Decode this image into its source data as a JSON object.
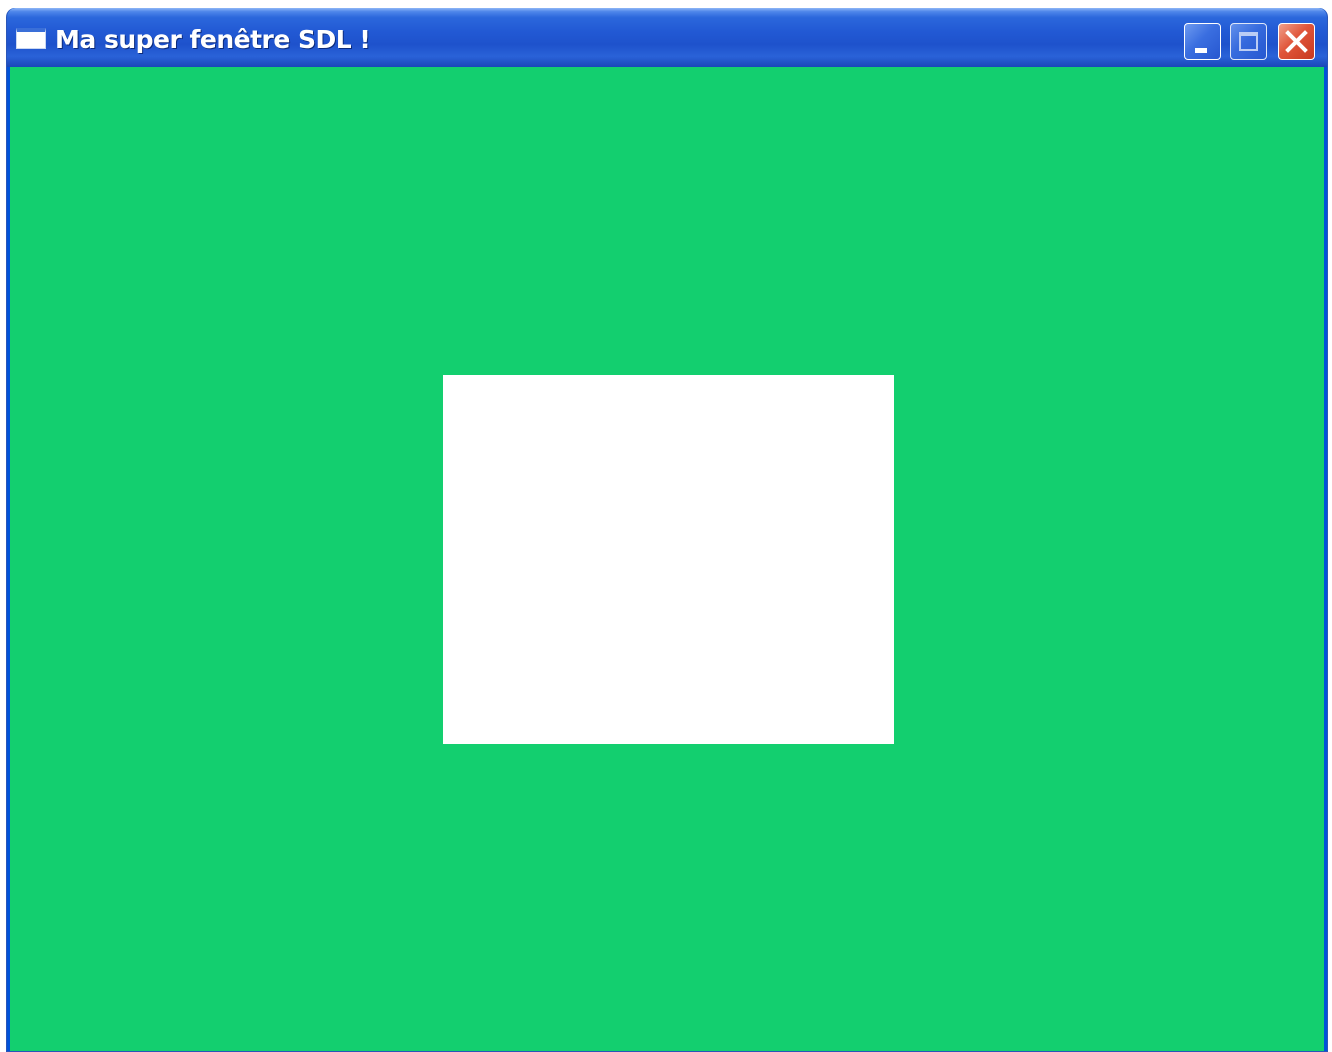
{
  "window": {
    "title": "Ma super fenêtre SDL !",
    "app_icon": "window-icon",
    "controls": {
      "minimize_icon": "minimize-icon",
      "maximize_icon": "maximize-icon",
      "close_icon": "close-icon"
    }
  },
  "canvas": {
    "background_color": "#13cf6f",
    "square_color": "#ffffff"
  }
}
